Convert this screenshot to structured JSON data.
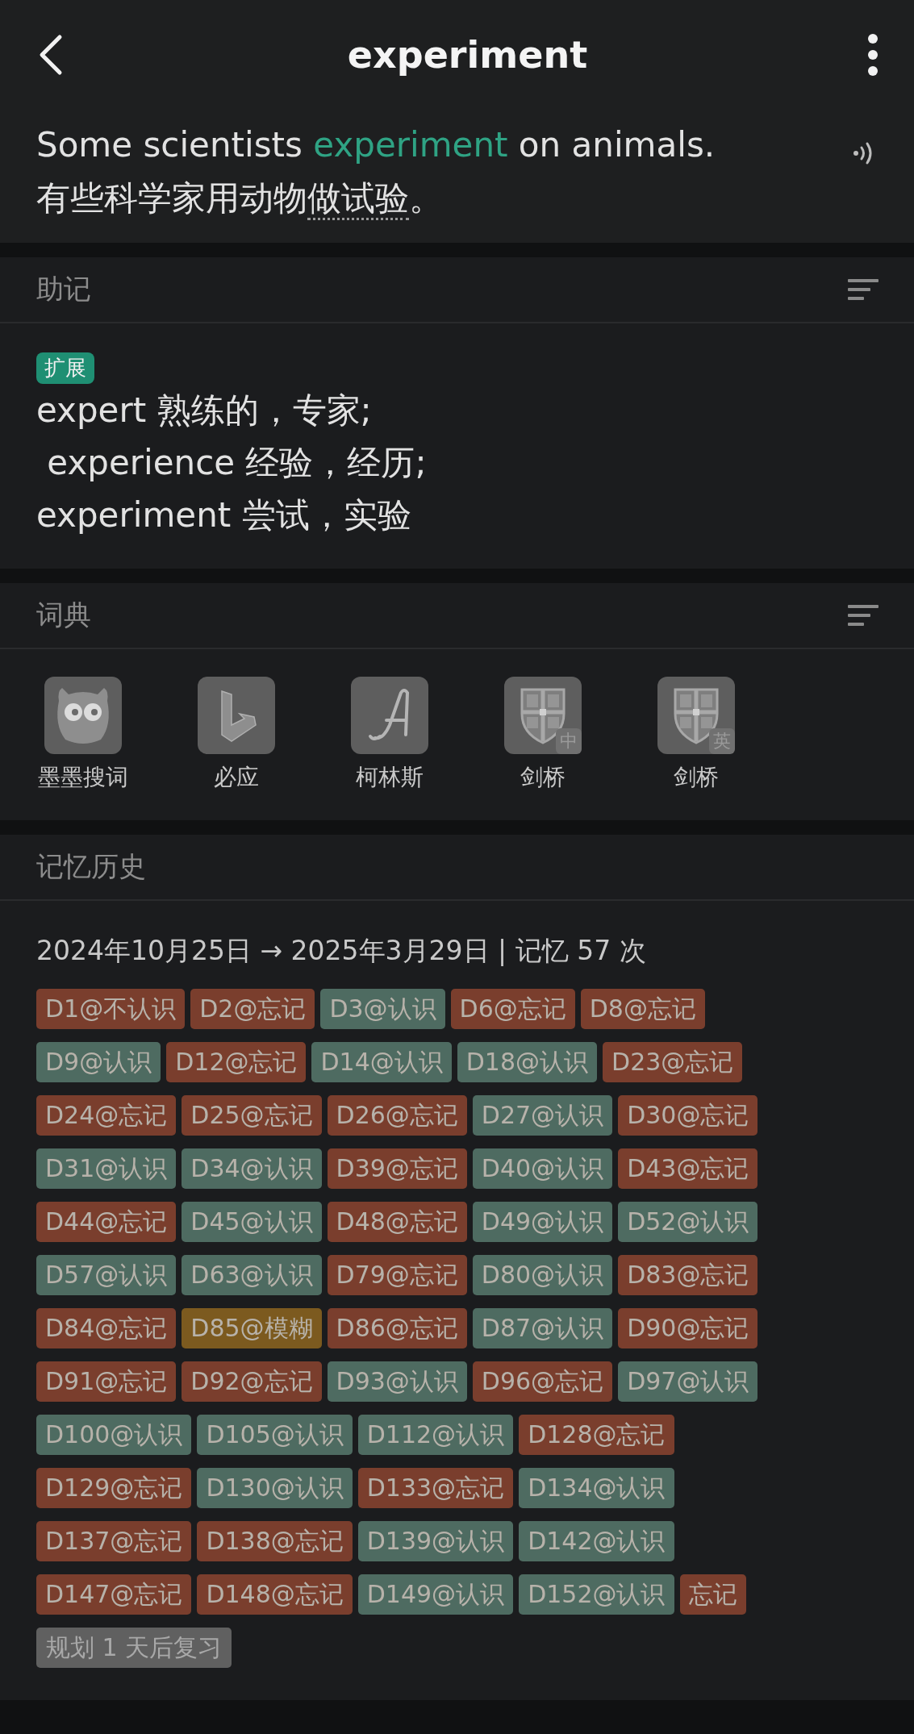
{
  "header": {
    "title": "experiment"
  },
  "example": {
    "sentence": [
      {
        "text": "Some scientists ",
        "highlight": false
      },
      {
        "text": "experiment",
        "highlight": true
      },
      {
        "text": " on animals.",
        "highlight": false
      }
    ],
    "translation": [
      {
        "text": "有些科学家用动物",
        "underlined": false
      },
      {
        "text": "做试验",
        "underlined": true
      },
      {
        "text": "。",
        "underlined": false
      }
    ]
  },
  "mnemonic": {
    "title": "助记",
    "tag": "扩展",
    "lines": [
      "expert 熟练的，专家;",
      " experience 经验，经历;",
      "experiment 尝试，实验"
    ]
  },
  "dictionary": {
    "title": "词典",
    "items": [
      {
        "label": "墨墨搜词",
        "kind": "owl"
      },
      {
        "label": "必应",
        "kind": "bing"
      },
      {
        "label": "柯林斯",
        "kind": "collins"
      },
      {
        "label": "剑桥",
        "kind": "cambridge",
        "badge": "中"
      },
      {
        "label": "剑桥",
        "kind": "cambridge",
        "badge": "英"
      }
    ]
  },
  "history": {
    "title": "记忆历史",
    "summary": "2024年10月25日 → 2025年3月29日 | 记忆 57 次",
    "tags": [
      {
        "label": "D1@不认识",
        "color": "#7a3e2d"
      },
      {
        "label": "D2@忘记",
        "color": "#7a3e2d"
      },
      {
        "label": "D3@认识",
        "color": "#4e6b61"
      },
      {
        "label": "D6@忘记",
        "color": "#7a3e2d"
      },
      {
        "label": "D8@忘记",
        "color": "#7a3e2d"
      },
      {
        "label": "D9@认识",
        "color": "#4e6b61"
      },
      {
        "label": "D12@忘记",
        "color": "#7a3e2d"
      },
      {
        "label": "D14@认识",
        "color": "#4e6b61"
      },
      {
        "label": "D18@认识",
        "color": "#4e6b61"
      },
      {
        "label": "D23@忘记",
        "color": "#7a3e2d"
      },
      {
        "label": "D24@忘记",
        "color": "#7a3e2d"
      },
      {
        "label": "D25@忘记",
        "color": "#7a3e2d"
      },
      {
        "label": "D26@忘记",
        "color": "#7a3e2d"
      },
      {
        "label": "D27@认识",
        "color": "#4e6b61"
      },
      {
        "label": "D30@忘记",
        "color": "#7a3e2d"
      },
      {
        "label": "D31@认识",
        "color": "#4e6b61"
      },
      {
        "label": "D34@认识",
        "color": "#4e6b61"
      },
      {
        "label": "D39@忘记",
        "color": "#7a3e2d"
      },
      {
        "label": "D40@认识",
        "color": "#4e6b61"
      },
      {
        "label": "D43@忘记",
        "color": "#7a3e2d"
      },
      {
        "label": "D44@忘记",
        "color": "#7a3e2d"
      },
      {
        "label": "D45@认识",
        "color": "#4e6b61"
      },
      {
        "label": "D48@忘记",
        "color": "#7a3e2d"
      },
      {
        "label": "D49@认识",
        "color": "#4e6b61"
      },
      {
        "label": "D52@认识",
        "color": "#4e6b61"
      },
      {
        "label": "D57@认识",
        "color": "#4e6b61"
      },
      {
        "label": "D63@认识",
        "color": "#4e6b61"
      },
      {
        "label": "D79@忘记",
        "color": "#7a3e2d"
      },
      {
        "label": "D80@认识",
        "color": "#4e6b61"
      },
      {
        "label": "D83@忘记",
        "color": "#7a3e2d"
      },
      {
        "label": "D84@忘记",
        "color": "#7a3e2d"
      },
      {
        "label": "D85@模糊",
        "color": "#7c5a1f"
      },
      {
        "label": "D86@忘记",
        "color": "#7a3e2d"
      },
      {
        "label": "D87@认识",
        "color": "#4e6b61"
      },
      {
        "label": "D90@忘记",
        "color": "#7a3e2d"
      },
      {
        "label": "D91@忘记",
        "color": "#7a3e2d"
      },
      {
        "label": "D92@忘记",
        "color": "#7a3e2d"
      },
      {
        "label": "D93@认识",
        "color": "#4e6b61"
      },
      {
        "label": "D96@忘记",
        "color": "#7a3e2d"
      },
      {
        "label": "D97@认识",
        "color": "#4e6b61"
      },
      {
        "label": "D100@认识",
        "color": "#4e6b61"
      },
      {
        "label": "D105@认识",
        "color": "#4e6b61"
      },
      {
        "label": "D112@认识",
        "color": "#4e6b61"
      },
      {
        "label": "D128@忘记",
        "color": "#7a3e2d"
      },
      {
        "label": "D129@忘记",
        "color": "#7a3e2d"
      },
      {
        "label": "D130@认识",
        "color": "#4e6b61"
      },
      {
        "label": "D133@忘记",
        "color": "#7a3e2d"
      },
      {
        "label": "D134@认识",
        "color": "#4e6b61"
      },
      {
        "label": "D137@忘记",
        "color": "#7a3e2d"
      },
      {
        "label": "D138@忘记",
        "color": "#7a3e2d"
      },
      {
        "label": "D139@认识",
        "color": "#4e6b61"
      },
      {
        "label": "D142@认识",
        "color": "#4e6b61"
      },
      {
        "label": "D147@忘记",
        "color": "#7a3e2d"
      },
      {
        "label": "D148@忘记",
        "color": "#7a3e2d"
      },
      {
        "label": "D149@认识",
        "color": "#4e6b61"
      },
      {
        "label": "D152@认识",
        "color": "#4e6b61"
      },
      {
        "label": "忘记",
        "color": "#7a3e2d"
      }
    ],
    "plan": "规划 1 天后复习"
  }
}
